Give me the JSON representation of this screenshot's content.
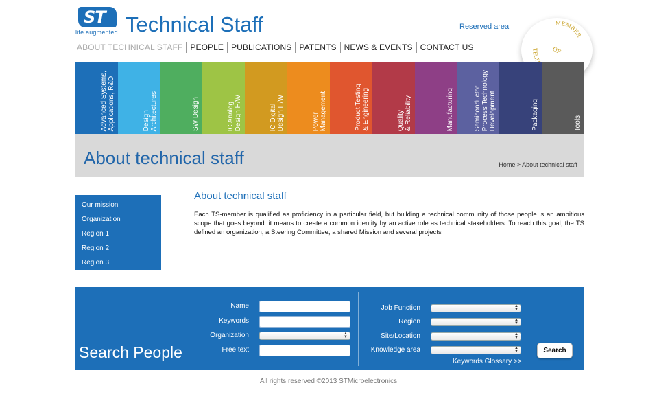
{
  "header": {
    "logo_text": "ST",
    "logo_tagline": "life.augmented",
    "site_title": "Technical Staff",
    "reserved_link": "Reserved area",
    "seal_text": "MEMBER OF TECHNICAL STAFF"
  },
  "nav": {
    "items": [
      {
        "label": "ABOUT TECHNICAL STAFF",
        "active": true
      },
      {
        "label": "PEOPLE"
      },
      {
        "label": "PUBLICATIONS"
      },
      {
        "label": "PATENTS"
      },
      {
        "label": "NEWS & EVENTS"
      },
      {
        "label": "CONTACT US"
      }
    ]
  },
  "categories": [
    {
      "label": "Advanced Systems,\nApplications, R&D",
      "color": "#1d6fb8"
    },
    {
      "label": "Design\nArchitectures",
      "color": "#3fb2e6"
    },
    {
      "label": "SW Design",
      "color": "#4fae5f"
    },
    {
      "label": "IC Analog\nDesign H/W",
      "color": "#9ec445"
    },
    {
      "label": "IC Digital\nDesign H/W",
      "color": "#d29a20"
    },
    {
      "label": "Power\nManagement",
      "color": "#ed8c1e"
    },
    {
      "label": "Product Testing\n& Engineering",
      "color": "#e0562f"
    },
    {
      "label": "Quality\n& Reliability",
      "color": "#b23a48"
    },
    {
      "label": "Manufacturing",
      "color": "#8e3f86"
    },
    {
      "label": "Semiconductor\nProcess Technology\nDevelopment",
      "color": "#5c61a0"
    },
    {
      "label": "Packaging",
      "color": "#37427a"
    },
    {
      "label": "Tools",
      "color": "#5a5a5a"
    }
  ],
  "banner": {
    "title": "About technical staff",
    "breadcrumb": "Home  >  About technical staff"
  },
  "sidemenu": {
    "items": [
      "Our mission",
      "Organization",
      "Region 1",
      "Region 2",
      "Region 3"
    ]
  },
  "content": {
    "title": "About technical staff",
    "text": "Each TS-member is qualified as proficiency in a particular field, but building a technical community of those people is an ambitious scope that goes beyond: it means to create a common identity by an active role as technical stakeholders. To reach this goal, the TS defined an organization, a Steering Committee, a shared Mission and several projects"
  },
  "search": {
    "title": "Search People",
    "name_label": "Name",
    "name_value": "",
    "keywords_label": "Keywords",
    "keywords_value": "",
    "organization_label": "Organization",
    "organization_value": "",
    "freetext_label": "Free text",
    "freetext_value": "",
    "jobfunction_label": "Job Function",
    "jobfunction_value": "",
    "region_label": "Region",
    "region_value": "",
    "site_label": "Site/Location",
    "site_value": "",
    "knowledge_label": "Knowledge area",
    "knowledge_value": "",
    "glossary_link": "Keywords Glossary >>",
    "button_label": "Search"
  },
  "footer": {
    "text": "All rights reserved ©2013 STMicroelectronics"
  },
  "colors": {
    "brand_blue": "#1d6fb8",
    "banner_gray": "#d9d9d9",
    "seal_gold": "#c9a227"
  }
}
